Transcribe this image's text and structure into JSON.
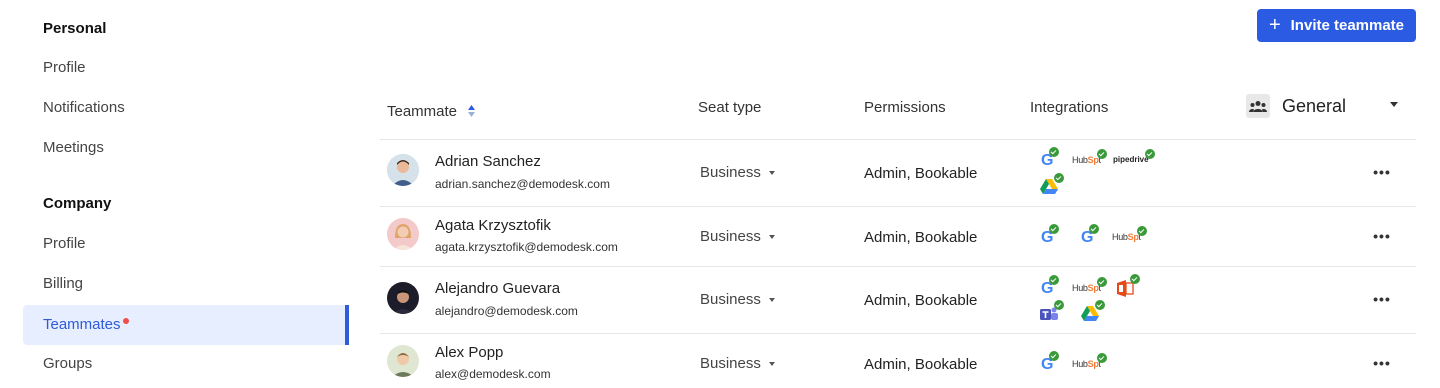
{
  "sidebar": {
    "personal_heading": "Personal",
    "personal_items": [
      "Profile",
      "Notifications",
      "Meetings"
    ],
    "company_heading": "Company",
    "company_items": [
      "Profile",
      "Billing",
      "Teammates",
      "Groups"
    ],
    "active_item": "Teammates"
  },
  "toolbar": {
    "invite_label": "Invite teammate"
  },
  "table": {
    "headers": {
      "teammate": "Teammate",
      "seat_type": "Seat type",
      "permissions": "Permissions",
      "integrations": "Integrations",
      "group": "General"
    },
    "rows": [
      {
        "name": "Adrian Sanchez",
        "email": "adrian.sanchez@demodesk.com",
        "seat": "Business",
        "permissions": "Admin, Bookable",
        "integrations": [
          "google",
          "hubspot",
          "pipedrive",
          "google-drive"
        ]
      },
      {
        "name": "Agata Krzysztofik",
        "email": "agata.krzysztofik@demodesk.com",
        "seat": "Business",
        "permissions": "Admin, Bookable",
        "integrations": [
          "google",
          "google",
          "hubspot"
        ]
      },
      {
        "name": "Alejandro Guevara",
        "email": "alejandro@demodesk.com",
        "seat": "Business",
        "permissions": "Admin, Bookable",
        "integrations": [
          "google",
          "hubspot",
          "office365",
          "teams",
          "google-drive"
        ]
      },
      {
        "name": "Alex Popp",
        "email": "alex@demodesk.com",
        "seat": "Business",
        "permissions": "Admin, Bookable",
        "integrations": [
          "google",
          "hubspot"
        ]
      }
    ],
    "more_label": "•••"
  },
  "logos": {
    "google": "G",
    "hubspot_a": "Hub",
    "hubspot_b": "Sp",
    "hubspot_c": "t",
    "pipedrive": "pipedrive"
  },
  "colors": {
    "accent": "#2c5be3",
    "active_bg": "#e6eeff",
    "check": "#3a9a3a",
    "notify_dot": "#f04c4c"
  }
}
